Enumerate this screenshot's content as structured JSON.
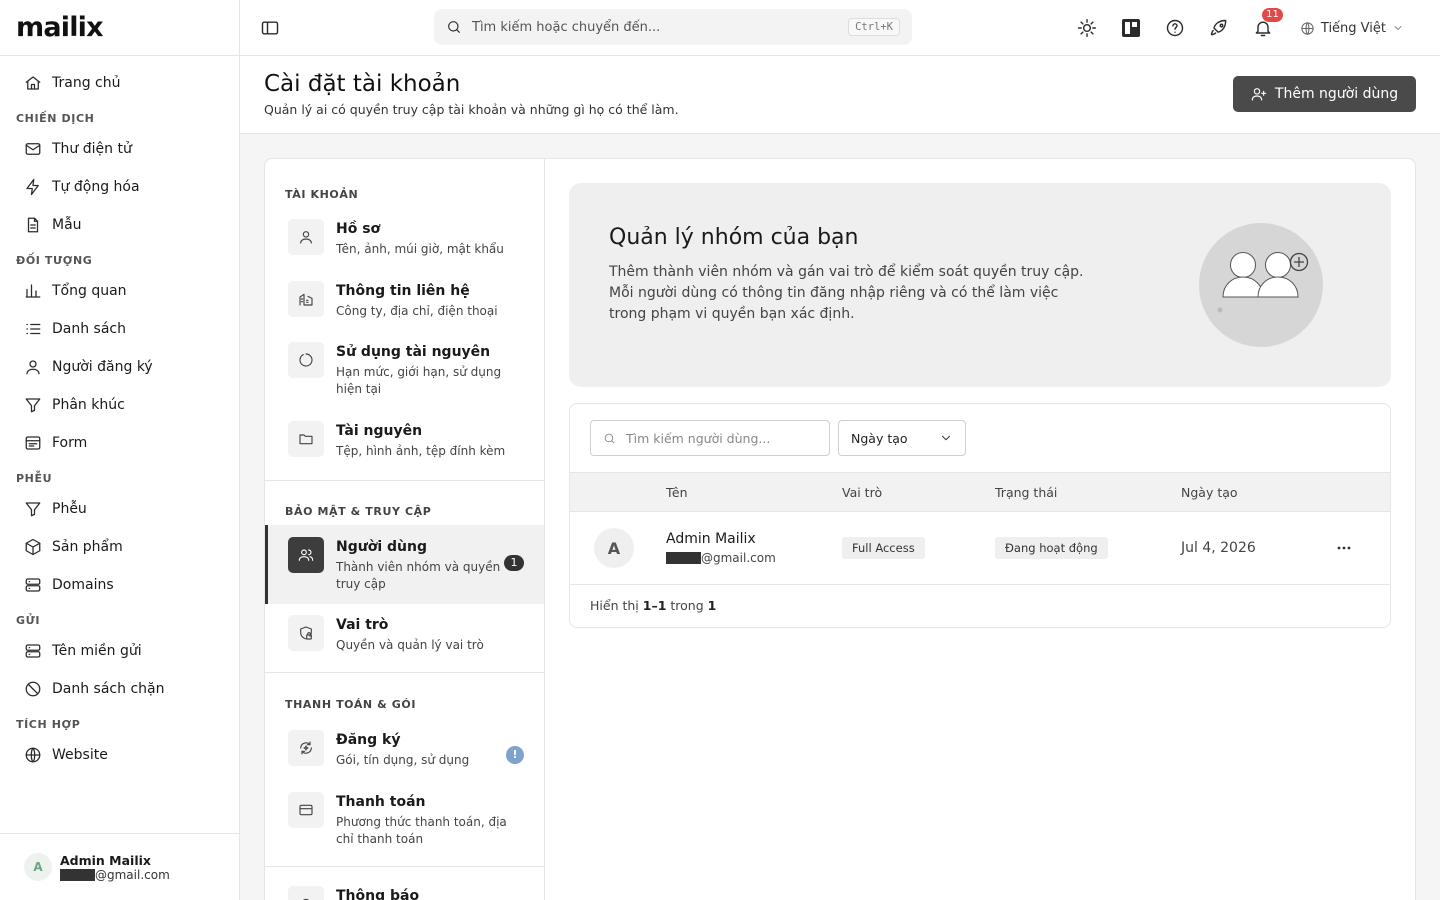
{
  "brand": {
    "logo": "mailix"
  },
  "sidebar": {
    "items": [
      {
        "type": "item",
        "label": "Trang chủ",
        "icon": "home-icon"
      },
      {
        "type": "section",
        "label": "CHIẾN DỊCH"
      },
      {
        "type": "item",
        "label": "Thư điện tử",
        "icon": "mail-icon"
      },
      {
        "type": "item",
        "label": "Tự động hóa",
        "icon": "zap-icon"
      },
      {
        "type": "item",
        "label": "Mẫu",
        "icon": "file-text-icon"
      },
      {
        "type": "section",
        "label": "ĐỐI TƯỢNG"
      },
      {
        "type": "item",
        "label": "Tổng quan",
        "icon": "bar-chart-icon"
      },
      {
        "type": "item",
        "label": "Danh sách",
        "icon": "list-icon"
      },
      {
        "type": "item",
        "label": "Người đăng ký",
        "icon": "user-icon"
      },
      {
        "type": "item",
        "label": "Phân khúc",
        "icon": "filter-icon"
      },
      {
        "type": "item",
        "label": "Form",
        "icon": "form-icon"
      },
      {
        "type": "section",
        "label": "PHỄU"
      },
      {
        "type": "item",
        "label": "Phễu",
        "icon": "funnel-icon"
      },
      {
        "type": "item",
        "label": "Sản phẩm",
        "icon": "package-icon"
      },
      {
        "type": "item",
        "label": "Domains",
        "icon": "server-icon"
      },
      {
        "type": "section",
        "label": "GỬI"
      },
      {
        "type": "item",
        "label": "Tên miền gửi",
        "icon": "server-icon"
      },
      {
        "type": "item",
        "label": "Danh sách chặn",
        "icon": "ban-icon"
      },
      {
        "type": "section",
        "label": "TÍCH HỢP"
      },
      {
        "type": "item",
        "label": "Website",
        "icon": "globe-icon"
      }
    ],
    "profile": {
      "initial": "A",
      "name": "Admin Mailix",
      "email_suffix": "@gmail.com"
    }
  },
  "topbar": {
    "search_placeholder": "Tìm kiếm hoặc chuyển đến...",
    "shortcut": "Ctrl+K",
    "notification_count": "11",
    "language": "Tiếng Việt"
  },
  "header": {
    "title": "Cài đặt tài khoản",
    "subtitle": "Quản lý ai có quyền truy cập tài khoản và những gì họ có thể làm.",
    "add_user_label": "Thêm người dùng"
  },
  "settings_nav": {
    "section_account": "TÀI KHOẢN",
    "profile": {
      "title": "Hồ sơ",
      "desc": "Tên, ảnh, múi giờ, mật khẩu"
    },
    "contact": {
      "title": "Thông tin liên hệ",
      "desc": "Công ty, địa chỉ, điện thoại"
    },
    "usage": {
      "title": "Sử dụng tài nguyên",
      "desc": "Hạn mức, giới hạn, sử dụng hiện tại"
    },
    "assets": {
      "title": "Tài nguyên",
      "desc": "Tệp, hình ảnh, tệp đính kèm"
    },
    "section_security": "BẢO MẬT & TRUY CẬP",
    "users": {
      "title": "Người dùng",
      "desc": "Thành viên nhóm và quyền truy cập",
      "count": "1"
    },
    "roles": {
      "title": "Vai trò",
      "desc": "Quyền và quản lý vai trò"
    },
    "section_billing": "THANH TOÁN & GÓI",
    "subscription": {
      "title": "Đăng ký",
      "desc": "Gói, tín dụng, sử dụng",
      "alert": "!"
    },
    "payment": {
      "title": "Thanh toán",
      "desc": "Phương thức thanh toán, địa chỉ thanh toán"
    },
    "notifications": {
      "title": "Thông báo"
    }
  },
  "hero": {
    "title": "Quản lý nhóm của bạn",
    "text": "Thêm thành viên nhóm và gán vai trò để kiểm soát quyền truy cập. Mỗi người dùng có thông tin đăng nhập riêng và có thể làm việc trong phạm vi quyền bạn xác định."
  },
  "users_table": {
    "search_placeholder": "Tìm kiếm người dùng...",
    "sort_value": "Ngày tạo",
    "columns": {
      "name": "Tên",
      "role": "Vai trò",
      "status": "Trạng thái",
      "created": "Ngày tạo"
    },
    "rows": [
      {
        "initial": "A",
        "name": "Admin Mailix",
        "email_suffix": "@gmail.com",
        "role": "Full Access",
        "status": "Đang hoạt động",
        "created": "Jul 4, 2026"
      }
    ],
    "footer": {
      "prefix": "Hiển thị",
      "range": "1–1",
      "middle": "trong",
      "total": "1"
    }
  }
}
